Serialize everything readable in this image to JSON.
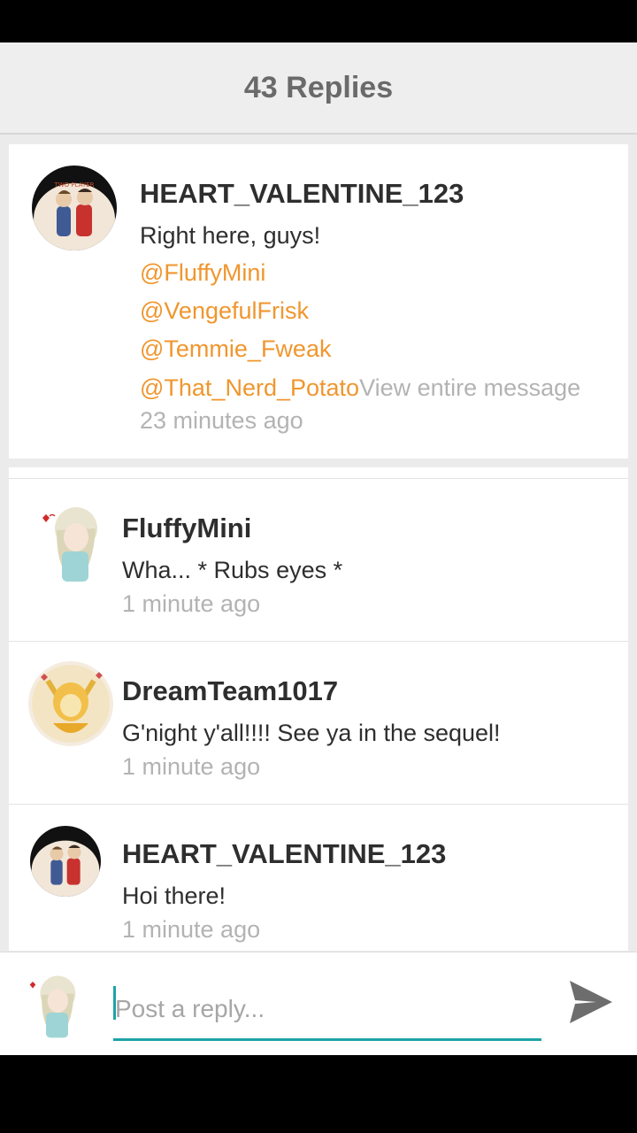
{
  "header": {
    "title": "43 Replies"
  },
  "main_post": {
    "username": "HEART_VALENTINE_123",
    "text": "Right here, guys!",
    "mentions": [
      "@FluffyMini",
      "@VengefulFrisk",
      "@Temmie_Fweak",
      "@That_Nerd_Potato"
    ],
    "view_more": "View entire message",
    "time": "23 minutes ago",
    "avatar_text": "WE MIGHT BE A TWO PLAYER GAME"
  },
  "replies": [
    {
      "username": "FluffyMini",
      "text": "Wha... * Rubs eyes *",
      "time": "1 minute ago"
    },
    {
      "username": "DreamTeam1017",
      "text": "G'night y'all!!!! See ya in the sequel!",
      "time": "1 minute ago"
    },
    {
      "username": "HEART_VALENTINE_123",
      "text": "Hoi there!",
      "time": "1 minute ago"
    }
  ],
  "composer": {
    "placeholder": "Post a reply..."
  },
  "colors": {
    "mention": "#f0962e",
    "accent": "#1ea3a6",
    "muted": "#b3b3b3"
  },
  "icons": {
    "send": "send-icon"
  }
}
